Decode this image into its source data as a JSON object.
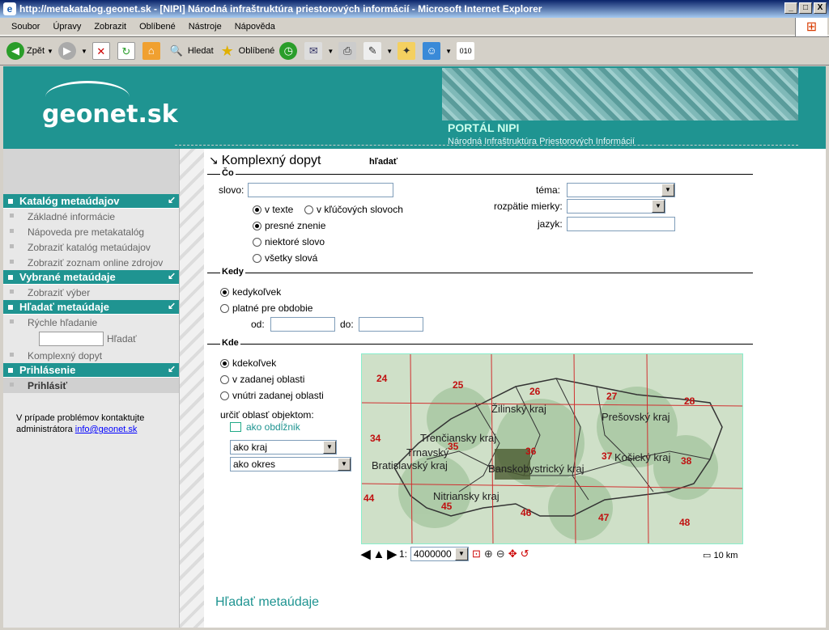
{
  "window": {
    "title": "http://metakatalog.geonet.sk - [NIPI] Národná infraštruktúra priestorových informácií - Microsoft Internet Explorer",
    "controls": [
      "_",
      "□",
      "X"
    ]
  },
  "menu": [
    "Soubor",
    "Úpravy",
    "Zobrazit",
    "Oblíbené",
    "Nástroje",
    "Nápověda"
  ],
  "toolbar": {
    "back": "Zpět",
    "search": "Hledat",
    "favorites": "Oblíbené"
  },
  "header": {
    "logo": "geonet.sk",
    "portal_title": "PORTÁL NIPI",
    "portal_sub": "Národná Infraštruktúra Priestorových Informácií"
  },
  "sidebar": {
    "sections": [
      {
        "title": "Katalóg metaúdajov",
        "items": [
          "Základné informácie",
          "Nápoveda pre metakatalóg",
          "Zobraziť katalóg metaúdajov",
          "Zobraziť zoznam online zdrojov"
        ]
      },
      {
        "title": "Vybrané metaúdaje",
        "items": [
          "Zobraziť výber"
        ]
      },
      {
        "title": "Hľadať metaúdaje",
        "items": [
          "Rýchle hľadanie",
          "Komplexný dopyt"
        ],
        "search_button": "Hľadať"
      },
      {
        "title": "Prihlásenie",
        "items": [
          "Prihlásiť"
        ]
      }
    ],
    "contact_text": "V prípade problémov kontaktujte administrátora",
    "contact_email": "info@geonet.sk"
  },
  "main": {
    "title": "Komplexný dopyt",
    "title_sub": "hľadať",
    "co": {
      "legend": "Čo",
      "slovo_label": "slovo:",
      "scope_options": [
        "v texte",
        "v kľúčových slovoch"
      ],
      "match_options": [
        "presné znenie",
        "niektoré slovo",
        "všetky slová"
      ],
      "tema_label": "téma:",
      "mierka_label": "rozpätie mierky:",
      "jazyk_label": "jazyk:"
    },
    "kedy": {
      "legend": "Kedy",
      "options": [
        "kedykoľvek",
        "platné pre obdobie"
      ],
      "od_label": "od:",
      "do_label": "do:"
    },
    "kde": {
      "legend": "Kde",
      "options": [
        "kdekoľvek",
        "v zadanej oblasti",
        "vnútri zadanej oblasti"
      ],
      "urcit_label": "určiť oblasť objektom:",
      "rect_link": "ako obdĺžnik",
      "kraj_select": "ako kraj",
      "okres_select": "ako okres"
    },
    "map": {
      "regions": [
        "Žilinský kraj",
        "Prešovský kraj",
        "Trenčiansky kraj",
        "Trnavský",
        "Bratislavský kraj",
        "Banskobystrický kraj",
        "Košický kraj",
        "Nitriansky kraj"
      ],
      "grid_numbers": [
        "24",
        "25",
        "26",
        "27",
        "28",
        "34",
        "35",
        "36",
        "37",
        "38",
        "44",
        "45",
        "46",
        "47",
        "48"
      ],
      "scale_prefix": "1:",
      "scale_value": "4000000",
      "scale_bar": "10 km"
    },
    "footer_heading": "Hľadať metaúdaje"
  }
}
